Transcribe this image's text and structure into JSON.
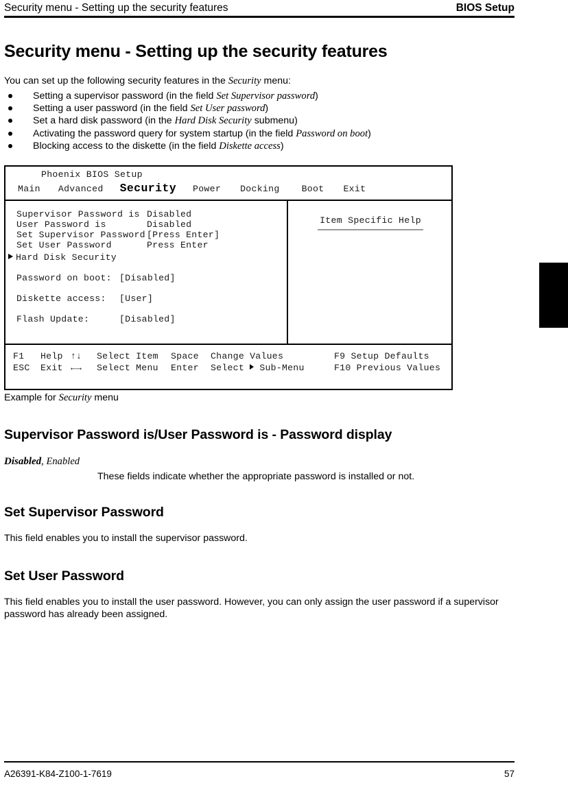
{
  "header": {
    "left_title": "Security menu - Setting up the security features",
    "right_title": "BIOS Setup"
  },
  "page_title": "Security menu - Setting up the security features",
  "intro": {
    "before": "You can set up the following security features in the ",
    "emphasis": "Security",
    "after": " menu:"
  },
  "bullets": [
    {
      "before": "Setting a supervisor password (in the field ",
      "emphasis": "Set Supervisor password",
      "after": ")"
    },
    {
      "before": "Setting a user password (in the field ",
      "emphasis": "Set User password",
      "after": ")"
    },
    {
      "before": "Set a hard disk password (in the ",
      "emphasis": "Hard Disk Security",
      "after": " submenu)"
    },
    {
      "before": "Activating the password query for system startup (in the field ",
      "emphasis": "Password on boot",
      "after": ")"
    },
    {
      "before": "Blocking access to the diskette (in the field ",
      "emphasis": "Diskette access",
      "after": ")"
    }
  ],
  "bios": {
    "brand": "Phoenix BIOS Setup",
    "tabs": [
      {
        "label": "Main",
        "active": false
      },
      {
        "label": "Advanced",
        "active": false
      },
      {
        "label": "Security",
        "active": true
      },
      {
        "label": "Power",
        "active": false
      },
      {
        "label": "Docking",
        "active": false
      },
      {
        "label": "Boot",
        "active": false
      },
      {
        "label": "Exit",
        "active": false
      }
    ],
    "settings": [
      {
        "label": "Supervisor Password is",
        "value": "Disabled"
      },
      {
        "label": "User Password is",
        "value": "Disabled"
      },
      {
        "label": "Set Supervisor Password",
        "value": "[Press Enter]"
      },
      {
        "label": "Set User Password",
        "value": "Press Enter"
      }
    ],
    "submenu": {
      "marker": "triangle-right-icon",
      "label": "Hard Disk Security"
    },
    "options": [
      {
        "label": "Password on boot:",
        "value": "[Disabled]"
      },
      {
        "label": "Diskette access:",
        "value": "[User]"
      },
      {
        "label": "Flash Update:",
        "value": "[Disabled]"
      }
    ],
    "help_panel": {
      "title": "Item Specific Help"
    },
    "keybar": {
      "row1": {
        "k1": "F1",
        "a1": "Help",
        "k2": "↑↓",
        "a2": "Select Item",
        "k3": "Space",
        "a3": "Change Values",
        "k4": "F9",
        "a4": "Setup Defaults"
      },
      "row2": {
        "k1": "ESC",
        "a1": "Exit",
        "k2": "←→",
        "a2": "Select Menu",
        "k3": "Enter",
        "a3_before": "Select ",
        "a3_after": " Sub-Menu",
        "k4": "F10",
        "a4": "Previous Values"
      }
    }
  },
  "caption": {
    "before": "Example for ",
    "emphasis": "Security",
    "after": " menu"
  },
  "sections": [
    {
      "heading": "Supervisor Password is/User Password is - Password display",
      "values_bold": "Disabled",
      "values_sep": ", ",
      "values_plain": "Enabled",
      "indented_text": "These fields indicate whether the appropriate password is installed or not."
    },
    {
      "heading": "Set Supervisor Password",
      "text": "This field enables you to install the supervisor password."
    },
    {
      "heading": "Set User Password",
      "text": "This field enables you to install the user password. However, you can only assign the user password if a supervisor password has already been assigned."
    }
  ],
  "footer": {
    "doc_number": "A26391-K84-Z100-1-7619",
    "page_number": "57"
  }
}
